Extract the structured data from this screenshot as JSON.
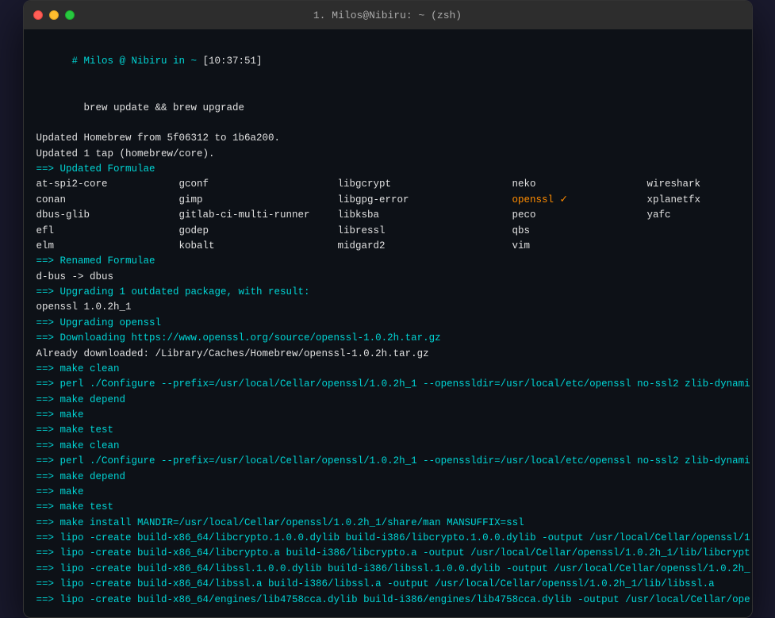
{
  "window": {
    "title": "1. Milos@Nibiru: ~ (zsh)"
  },
  "terminal": {
    "lines": [
      {
        "type": "prompt",
        "text": "# Milos @ Nibiru in ~ [10:37:51]"
      },
      {
        "type": "cmd",
        "text": "  brew update && brew upgrade"
      },
      {
        "type": "normal",
        "text": "Updated Homebrew from 5f06312 to 1b6a200."
      },
      {
        "type": "normal",
        "text": "Updated 1 tap (homebrew/core)."
      },
      {
        "type": "arrow-header",
        "text": "==> Updated Formulae"
      },
      {
        "type": "formulae-grid"
      },
      {
        "type": "arrow-header",
        "text": "==> Renamed Formulae"
      },
      {
        "type": "normal",
        "text": "d-bus -> dbus"
      },
      {
        "type": "arrow-header",
        "text": "==> Upgrading 1 outdated package, with result:"
      },
      {
        "type": "normal",
        "text": "openssl 1.0.2h_1"
      },
      {
        "type": "arrow-header",
        "text": "==> Upgrading openssl"
      },
      {
        "type": "arrow-header",
        "text": "==> Downloading https://www.openssl.org/source/openssl-1.0.2h.tar.gz"
      },
      {
        "type": "normal",
        "text": "Already downloaded: /Library/Caches/Homebrew/openssl-1.0.2h.tar.gz"
      },
      {
        "type": "arrow-header",
        "text": "==> make clean"
      },
      {
        "type": "arrow-header",
        "text": "==> perl ./Configure --prefix=/usr/local/Cellar/openssl/1.0.2h_1 --openssldir=/usr/local/etc/openssl no-ssl2 zlib-dynami"
      },
      {
        "type": "arrow-header",
        "text": "==> make depend"
      },
      {
        "type": "arrow-header",
        "text": "==> make"
      },
      {
        "type": "arrow-header",
        "text": "==> make test"
      },
      {
        "type": "arrow-header",
        "text": "==> make clean"
      },
      {
        "type": "arrow-header",
        "text": "==> perl ./Configure --prefix=/usr/local/Cellar/openssl/1.0.2h_1 --openssldir=/usr/local/etc/openssl no-ssl2 zlib-dynami"
      },
      {
        "type": "arrow-header",
        "text": "==> make depend"
      },
      {
        "type": "arrow-header",
        "text": "==> make"
      },
      {
        "type": "arrow-header",
        "text": "==> make test"
      },
      {
        "type": "arrow-header",
        "text": "==> make install MANDIR=/usr/local/Cellar/openssl/1.0.2h_1/share/man MANSUFFIX=ssl"
      },
      {
        "type": "arrow-header",
        "text": "==> lipo -create build-x86_64/libcrypto.1.0.0.dylib build-i386/libcrypto.1.0.0.dylib -output /usr/local/Cellar/openssl/1"
      },
      {
        "type": "arrow-header",
        "text": "==> lipo -create build-x86_64/libcrypto.a build-i386/libcrypto.a -output /usr/local/Cellar/openssl/1.0.2h_1/lib/libcrypt"
      },
      {
        "type": "arrow-header",
        "text": "==> lipo -create build-x86_64/libssl.1.0.0.dylib build-i386/libssl.1.0.0.dylib -output /usr/local/Cellar/openssl/1.0.2h_"
      },
      {
        "type": "arrow-header",
        "text": "==> lipo -create build-x86_64/libssl.a build-i386/libssl.a -output /usr/local/Cellar/openssl/1.0.2h_1/lib/libssl.a"
      },
      {
        "type": "arrow-header",
        "text": "==> lipo -create build-x86_64/engines/lib4758cca.dylib build-i386/engines/lib4758cca.dylib -output /usr/local/Cellar/ope"
      }
    ],
    "formulae": {
      "col1": [
        "at-spi2-core",
        "conan",
        "dbus-glib",
        "efl",
        "elm"
      ],
      "col2": [
        "gconf",
        "gimp",
        "gitlab-ci-multi-runner",
        "godep",
        "kobalt"
      ],
      "col3": [
        "libgcrypt",
        "libgpg-error",
        "libksba",
        "libressl",
        "midgard2"
      ],
      "col4": [
        "neko",
        "openssl ✓",
        "peco",
        "qbs",
        "vim"
      ],
      "col5": [
        "wireshark",
        "xplanetfx",
        "yafc",
        "",
        ""
      ]
    }
  }
}
